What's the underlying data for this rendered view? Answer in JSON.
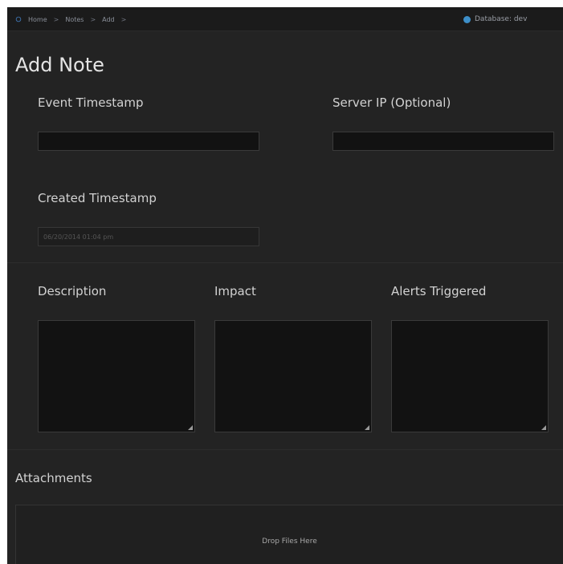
{
  "breadcrumb": {
    "items": [
      "Home",
      "Notes",
      "Add"
    ],
    "separator": ">"
  },
  "database": {
    "label": "Database: dev",
    "icon": "database-icon",
    "icon_color": "#3d8fc9"
  },
  "page": {
    "title": "Add Note"
  },
  "form": {
    "event_timestamp": {
      "label": "Event Timestamp",
      "value": ""
    },
    "server_ip": {
      "label": "Server IP (Optional)",
      "value": ""
    },
    "created_timestamp": {
      "label": "Created Timestamp",
      "value": "06/20/2014 01:04 pm"
    },
    "description": {
      "label": "Description"
    },
    "impact": {
      "label": "Impact"
    },
    "alerts_triggered": {
      "label": "Alerts Triggered"
    }
  },
  "attachments": {
    "label": "Attachments",
    "drop_text": "Drop Files Here"
  },
  "colors": {
    "background": "#232323",
    "input_background": "#121212",
    "text": "#d2d2d2",
    "accent": "#3d8fc9"
  }
}
